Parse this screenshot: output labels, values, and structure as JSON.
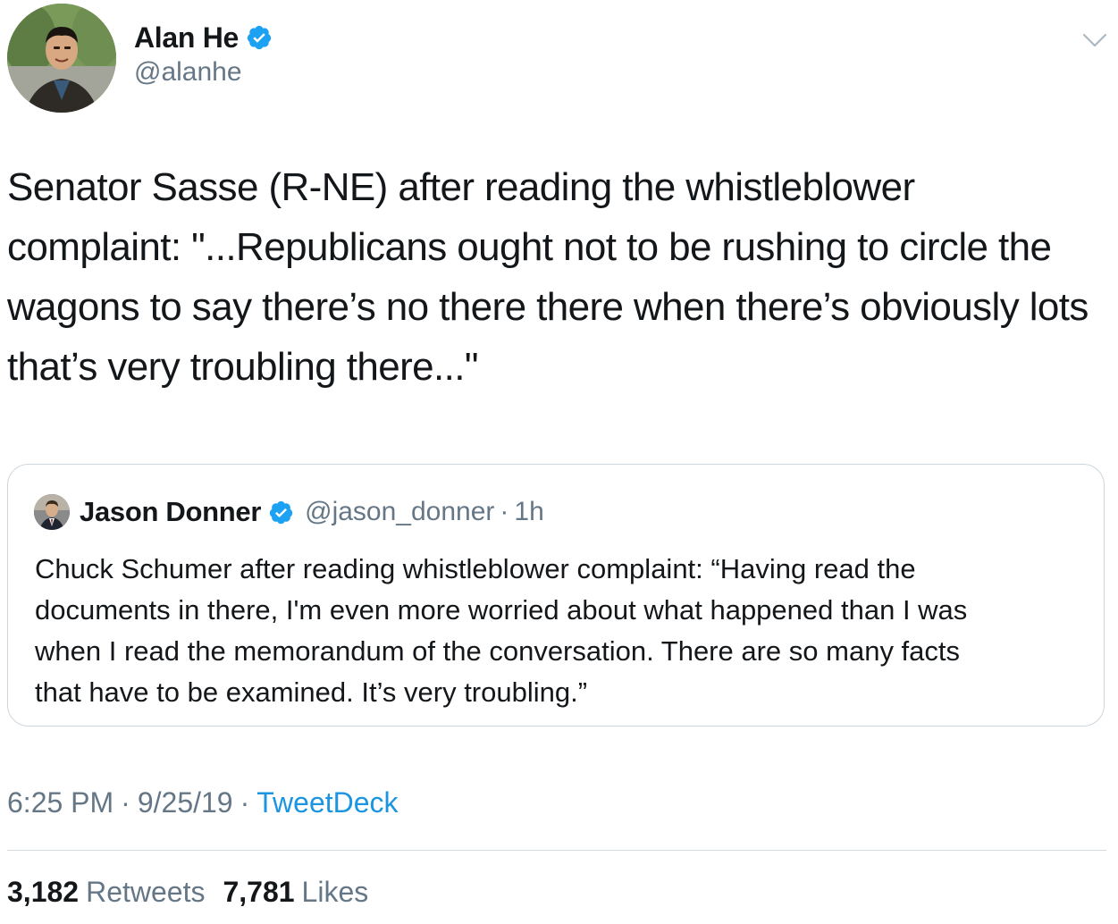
{
  "author": {
    "name": "Alan He",
    "handle": "@alanhe",
    "verified": true,
    "avatar_icon": "profile-photo"
  },
  "tweet": {
    "text": "Senator Sasse (R-NE) after reading the whistleblower\ncomplaint: \"...Republicans ought not to be rushing to circle the\nwagons to say there’s no there there when there’s obviously lots\nthat’s very troubling there...\""
  },
  "quoted_tweet": {
    "name": "Jason Donner",
    "handle": "@jason_donner",
    "separator": "·",
    "time": "1h",
    "verified": true,
    "text": "Chuck Schumer after reading whistleblower complaint: “Having read the\ndocuments in there, I'm even more worried about what happened than I was\nwhen I read the memorandum of the conversation. There are so many facts\nthat have to be examined. It’s very troubling.”"
  },
  "meta": {
    "time": "6:25 PM",
    "sep1": "·",
    "date": "9/25/19",
    "sep2": "·",
    "source": "TweetDeck"
  },
  "stats": {
    "retweets_count": "3,182",
    "retweets_label": "Retweets",
    "likes_count": "7,781",
    "likes_label": "Likes"
  },
  "colors": {
    "text": "#14171a",
    "secondary": "#657786",
    "link": "#1b95e0",
    "verified": "#1da1f2",
    "border": "#ccd6dd"
  }
}
